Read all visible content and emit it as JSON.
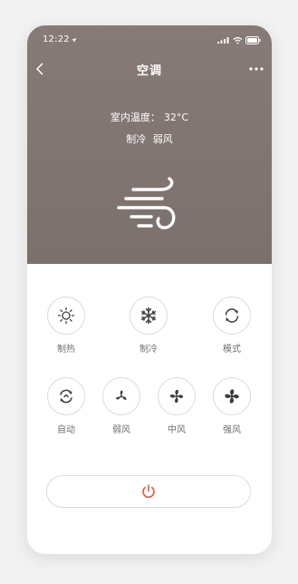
{
  "status_bar": {
    "time": "12:22"
  },
  "header": {
    "title": "空调"
  },
  "info": {
    "temp_label": "室内温度：",
    "temp_value": "32°C",
    "mode": "制冷",
    "wind": "弱风"
  },
  "controls": {
    "row1": [
      {
        "label": "制热",
        "icon": "sun-icon"
      },
      {
        "label": "制冷",
        "icon": "snowflake-icon"
      },
      {
        "label": "模式",
        "icon": "cycle-icon"
      }
    ],
    "row2": [
      {
        "label": "自动",
        "icon": "auto-icon"
      },
      {
        "label": "弱风",
        "icon": "fan-low-icon"
      },
      {
        "label": "中风",
        "icon": "fan-medium-icon"
      },
      {
        "label": "强风",
        "icon": "fan-high-icon"
      }
    ]
  },
  "power": {
    "icon": "power-icon"
  },
  "colors": {
    "hero_bg": "#817672",
    "icon_dark": "#3d3d3d",
    "power_accent": "#e8553a"
  }
}
